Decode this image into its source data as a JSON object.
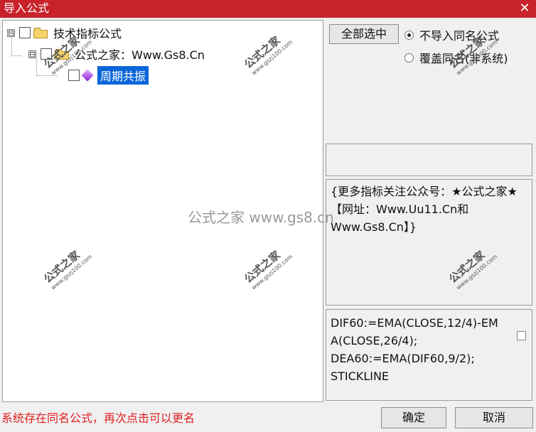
{
  "window": {
    "title": "导入公式",
    "close_glyph": "✕"
  },
  "tree": {
    "root": {
      "label": "技术指标公式",
      "expander": "⊟"
    },
    "group": {
      "label": "公式之家：Www.Gs8.Cn",
      "expander": "⊟"
    },
    "leaf": {
      "label": "周期共振"
    }
  },
  "buttons": {
    "select_all": "全部选中",
    "ok": "确定",
    "cancel": "取消"
  },
  "options": {
    "no_import_same_name": "不导入同名公式",
    "overwrite_same_name": "覆盖同名(非系统)",
    "selected": "no_import_same_name"
  },
  "description": "{更多指标关注公众号：★公式之家★【网址：Www.Uu11.Cn和Www.Gs8.Cn】}",
  "code_preview": "DIF60:=EMA(CLOSE,12/4)-EMA(CLOSE,26/4);\nDEA60:=EMA(DIF60,9/2);\nSTICKLINE",
  "status_message": "系统存在同名公式，再次点击可以更名",
  "watermark": {
    "title": "公式之家",
    "site": "www.gszj100.com",
    "center": "公式之家 www.gs8.cn"
  }
}
